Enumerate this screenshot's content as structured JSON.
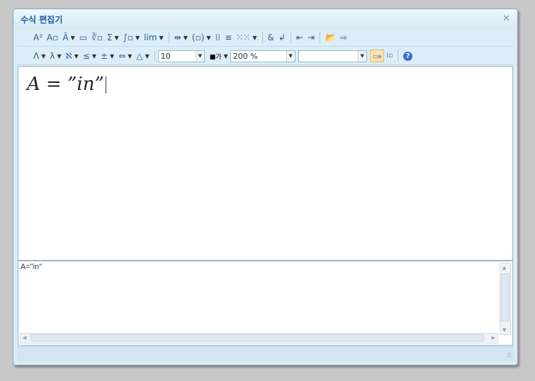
{
  "window": {
    "title": "수식 편집기",
    "close_glyph": "✕"
  },
  "toolbar1": [
    {
      "name": "superscript-button",
      "glyph": "A²",
      "dd": false
    },
    {
      "name": "subscript-button",
      "glyph": "A▫",
      "dd": false
    },
    {
      "name": "decoration-button",
      "glyph": "Ā",
      "dd": true
    },
    {
      "name": "fraction-button",
      "glyph": "▭",
      "dd": false
    },
    {
      "name": "root-button",
      "glyph": "∛▫",
      "dd": false
    },
    {
      "name": "sum-button",
      "glyph": "Σ",
      "dd": true
    },
    {
      "name": "integral-button",
      "glyph": "∫▫",
      "dd": true
    },
    {
      "name": "limit-button",
      "glyph": "lim",
      "dd": true
    },
    {
      "name": "sep1",
      "sep": true
    },
    {
      "name": "arrow-button",
      "glyph": "⇹",
      "dd": true
    },
    {
      "name": "bracket-button",
      "glyph": "(▫)",
      "dd": true
    },
    {
      "name": "matrix-button",
      "glyph": "⁞⁞",
      "dd": false
    },
    {
      "name": "align-button",
      "glyph": "≡",
      "dd": false
    },
    {
      "name": "grid-button",
      "glyph": "⁙⁙",
      "dd": true
    },
    {
      "name": "sep2",
      "sep": true
    },
    {
      "name": "ampersand-button",
      "glyph": "&",
      "dd": false
    },
    {
      "name": "newline-button",
      "glyph": "↲",
      "dd": false
    },
    {
      "name": "sep3",
      "sep": true
    },
    {
      "name": "prev-button",
      "glyph": "⇤",
      "dd": false
    },
    {
      "name": "next-button",
      "glyph": "⇥",
      "dd": false
    },
    {
      "name": "sep4",
      "sep": true
    },
    {
      "name": "open-button",
      "glyph": "📂",
      "dd": false
    },
    {
      "name": "insert-button",
      "glyph": "⇨",
      "dd": false
    }
  ],
  "toolbar2": {
    "left": [
      {
        "name": "greek-upper-button",
        "glyph": "Λ",
        "dd": true
      },
      {
        "name": "greek-lower-button",
        "glyph": "λ",
        "dd": true
      },
      {
        "name": "symbol-button",
        "glyph": "ℵ",
        "dd": true
      },
      {
        "name": "relation-button",
        "glyph": "≤",
        "dd": true
      },
      {
        "name": "operator-button",
        "glyph": "±",
        "dd": true
      },
      {
        "name": "arrows-button",
        "glyph": "⇔",
        "dd": true
      },
      {
        "name": "misc-button",
        "glyph": "△",
        "dd": true
      }
    ],
    "font_size": "10",
    "color_glyph": "■가",
    "zoom": "200 %",
    "style_value": "",
    "help_glyph": "?"
  },
  "editor": {
    "formula_a": "A",
    "formula_eq": " = ",
    "formula_rest": "”in”"
  },
  "script": {
    "text": "A=\"in\""
  },
  "colors": {
    "accent": "#1c5d9b",
    "toolbar": "#dbeef8"
  }
}
